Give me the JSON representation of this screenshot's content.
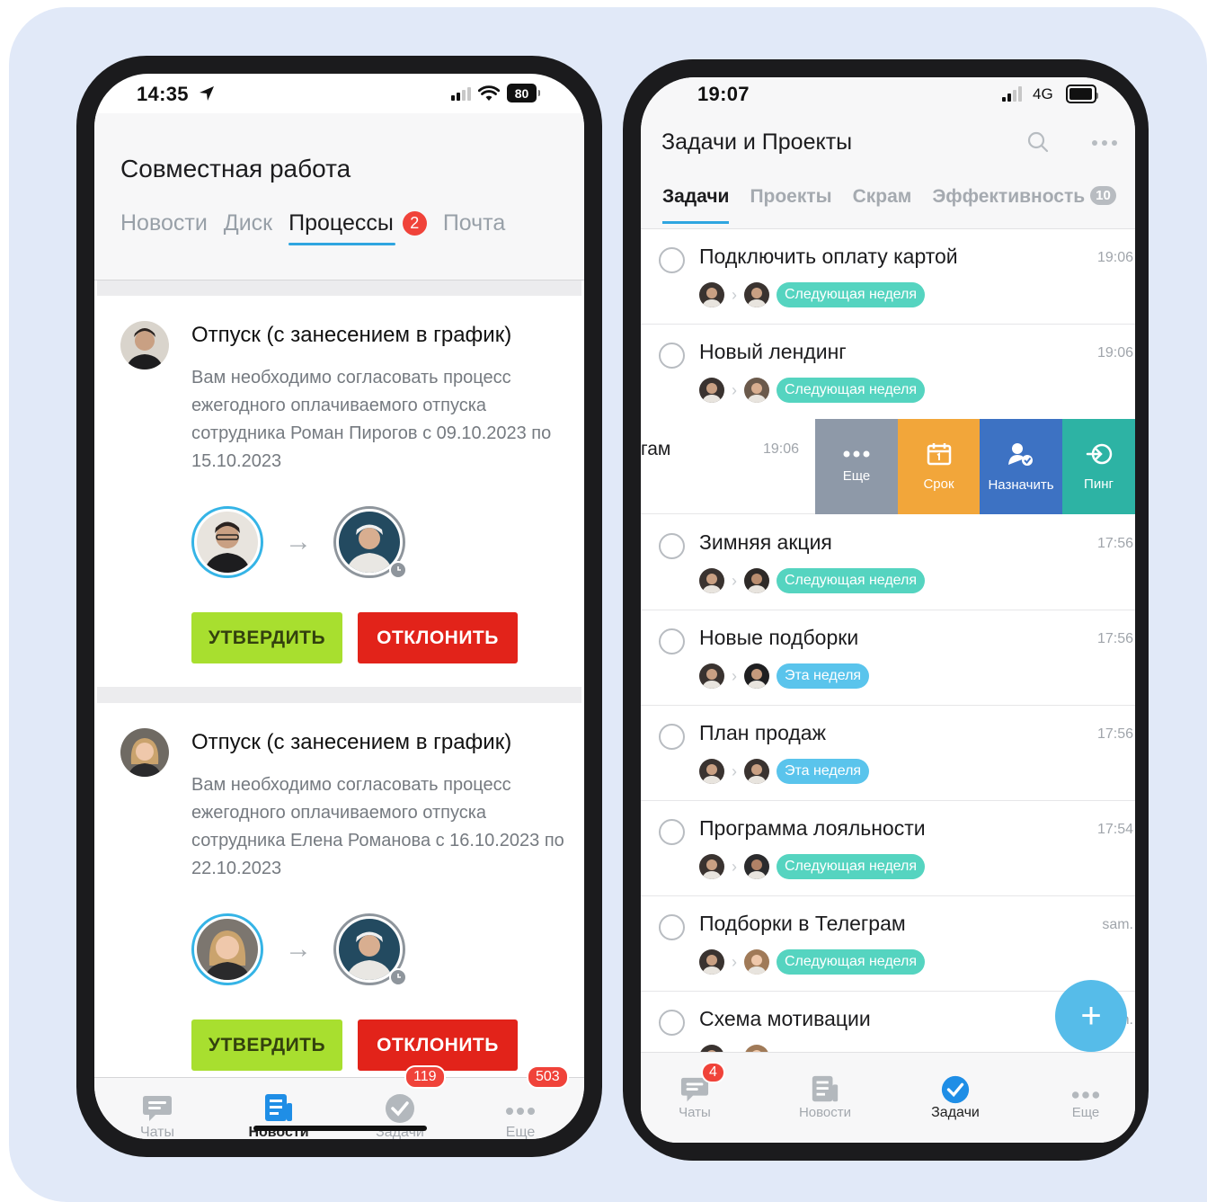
{
  "colors": {
    "background": "#e1e9f8",
    "accent": "#2fa5e0",
    "approve": "#a8df2f",
    "reject": "#e2231a",
    "badge": "#f0433a",
    "pill_next_week": "#55d4c0",
    "pill_this_week": "#5ac4ec",
    "action_more": "#8e99a8",
    "action_deadline": "#f2a63a",
    "action_assign": "#3d72c3",
    "action_ping": "#2db3a4"
  },
  "left_phone": {
    "status": {
      "time": "14:35",
      "battery": "80"
    },
    "title": "Совместная работа",
    "tabs": [
      {
        "label": "Новости",
        "active": false
      },
      {
        "label": "Диск",
        "active": false
      },
      {
        "label": "Процессы",
        "active": true,
        "badge": "2"
      },
      {
        "label": "Почта",
        "active": false
      }
    ],
    "cards": [
      {
        "title": "Отпуск (с занесением в график)",
        "text": "Вам необходимо согласовать процесс ежегодного оплачиваемого отпуска сотрудника Роман Пирогов с 09.10.2023 по 15.10.2023",
        "approve_label": "УТВЕРДИТЬ",
        "reject_label": "ОТКЛОНИТЬ"
      },
      {
        "title": "Отпуск (с занесением в график)",
        "text": "Вам необходимо согласовать процесс ежегодного оплачиваемого отпуска сотрудника Елена Романова с 16.10.2023 по 22.10.2023",
        "approve_label": "УТВЕРДИТЬ",
        "reject_label": "ОТКЛОНИТЬ"
      }
    ],
    "tabbar": [
      {
        "label": "Чаты",
        "icon": "chat-icon"
      },
      {
        "label": "Новости",
        "icon": "news-icon",
        "active": true
      },
      {
        "label": "Задачи",
        "icon": "tasks-icon",
        "badge": "119"
      },
      {
        "label": "Еще",
        "icon": "more-icon",
        "badge": "503"
      }
    ]
  },
  "right_phone": {
    "status": {
      "time": "19:07",
      "network": "4G"
    },
    "title": "Задачи и Проекты",
    "tabs": [
      {
        "label": "Задачи",
        "active": true
      },
      {
        "label": "Проекты"
      },
      {
        "label": "Скрам"
      },
      {
        "label": "Эффективность",
        "badge": "10"
      }
    ],
    "tasks": [
      {
        "title": "Подключить оплату картой",
        "time": "19:06",
        "deadline": "Следующая неделя",
        "kind": "next"
      },
      {
        "title": "Новый лендинг",
        "time": "19:06",
        "deadline": "Следующая неделя",
        "kind": "next"
      },
      {
        "title": "Зимняя акция",
        "time": "17:56",
        "deadline": "Следующая неделя",
        "kind": "next"
      },
      {
        "title": "Новые подборки",
        "time": "17:56",
        "deadline": "Эта неделя",
        "kind": "this"
      },
      {
        "title": "План продаж",
        "time": "17:56",
        "deadline": "Эта неделя",
        "kind": "this"
      },
      {
        "title": "Программа лояльности",
        "time": "17:54",
        "deadline": "Следующая неделя",
        "kind": "next"
      },
      {
        "title": "Подборки в Телеграм",
        "time": "sam.",
        "deadline": "Следующая неделя",
        "kind": "next"
      },
      {
        "title": "Схема мотивации",
        "time": "m.",
        "deadline": "",
        "kind": "next"
      }
    ],
    "swiped_row": {
      "text": "гам",
      "time": "19:06",
      "actions": [
        {
          "label": "Еще",
          "icon": "more-icon"
        },
        {
          "label": "Срок",
          "icon": "calendar-icon"
        },
        {
          "label": "Назначить",
          "icon": "assign-user-icon"
        },
        {
          "label": "Пинг",
          "icon": "ping-icon"
        }
      ]
    },
    "fab": "+",
    "tabbar": [
      {
        "label": "Чаты",
        "icon": "chat-icon",
        "badge": "4"
      },
      {
        "label": "Новости",
        "icon": "news-icon"
      },
      {
        "label": "Задачи",
        "icon": "tasks-check-icon",
        "active": true
      },
      {
        "label": "Еще",
        "icon": "more-icon"
      }
    ]
  }
}
